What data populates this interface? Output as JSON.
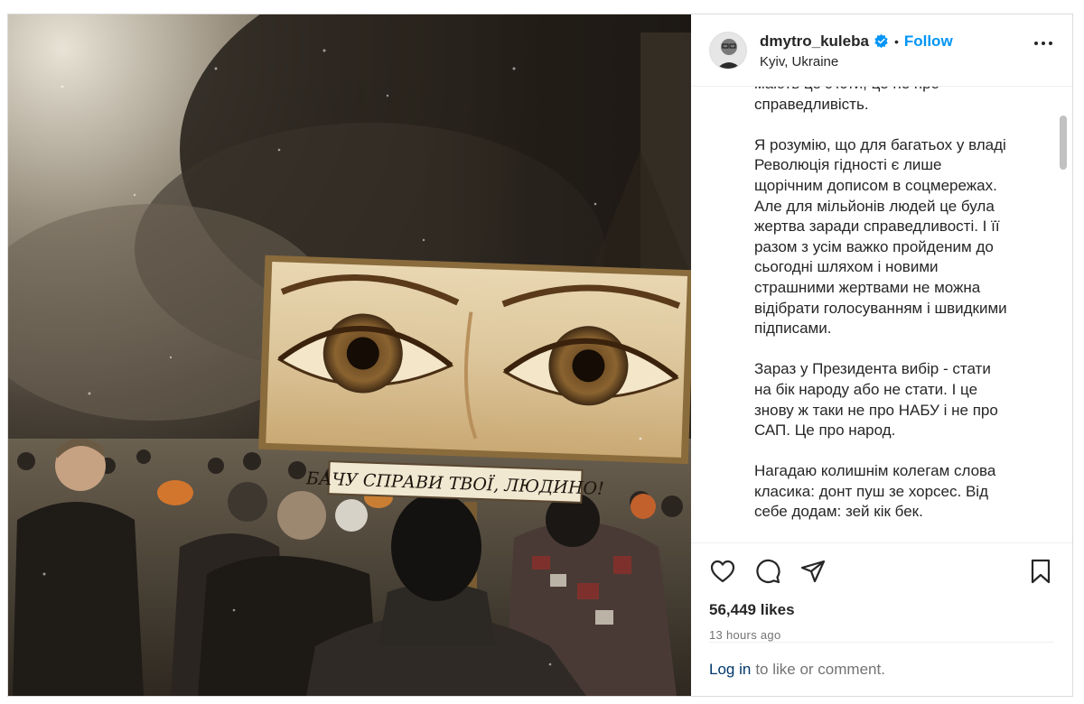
{
  "post": {
    "username": "dmytro_kuleba",
    "follow_label": "Follow",
    "separator": "•",
    "location": "Kyiv, Ukraine"
  },
  "image": {
    "sign_text": "БАЧУ СПРАВИ ТВОЇ, ЛЮДИНО!"
  },
  "caption": {
    "paragraphs": [
      "мають це з'їсти, це не про\nсправедливість.",
      "Я розумію, що для багатьох у владі\nРеволюція гідності є лише\nщорічним дописом в соцмережах.\nАле для мільйонів людей це була\nжертва заради справедливості. І її\nразом з усім важко пройденим до\nсьогодні шляхом і новими\nстрашними жертвами не можна\nвідібрати голосуванням і швидкими\nпідписами.",
      "Зараз у Президента вибір - стати\nна бік народу або не стати. І це\nзнову ж таки не про НАБУ і не про\nСАП. Це про народ.",
      "Нагадаю колишнім колегам слова\nкласика: донт пуш зе хорсес. Від\nсебе додам: зей кік бек."
    ]
  },
  "engagement": {
    "likes": "56,449 likes",
    "time": "13 hours ago",
    "login_link": "Log in",
    "login_suffix": "to like or comment."
  },
  "icons": {
    "verified": "verified-badge-icon",
    "more": "more-options-icon",
    "like": "heart-icon",
    "comment": "comment-icon",
    "share": "share-icon",
    "save": "bookmark-icon"
  },
  "colors": {
    "accent": "#0095f6",
    "link": "#00376b",
    "muted": "#737373",
    "text": "#262626"
  }
}
